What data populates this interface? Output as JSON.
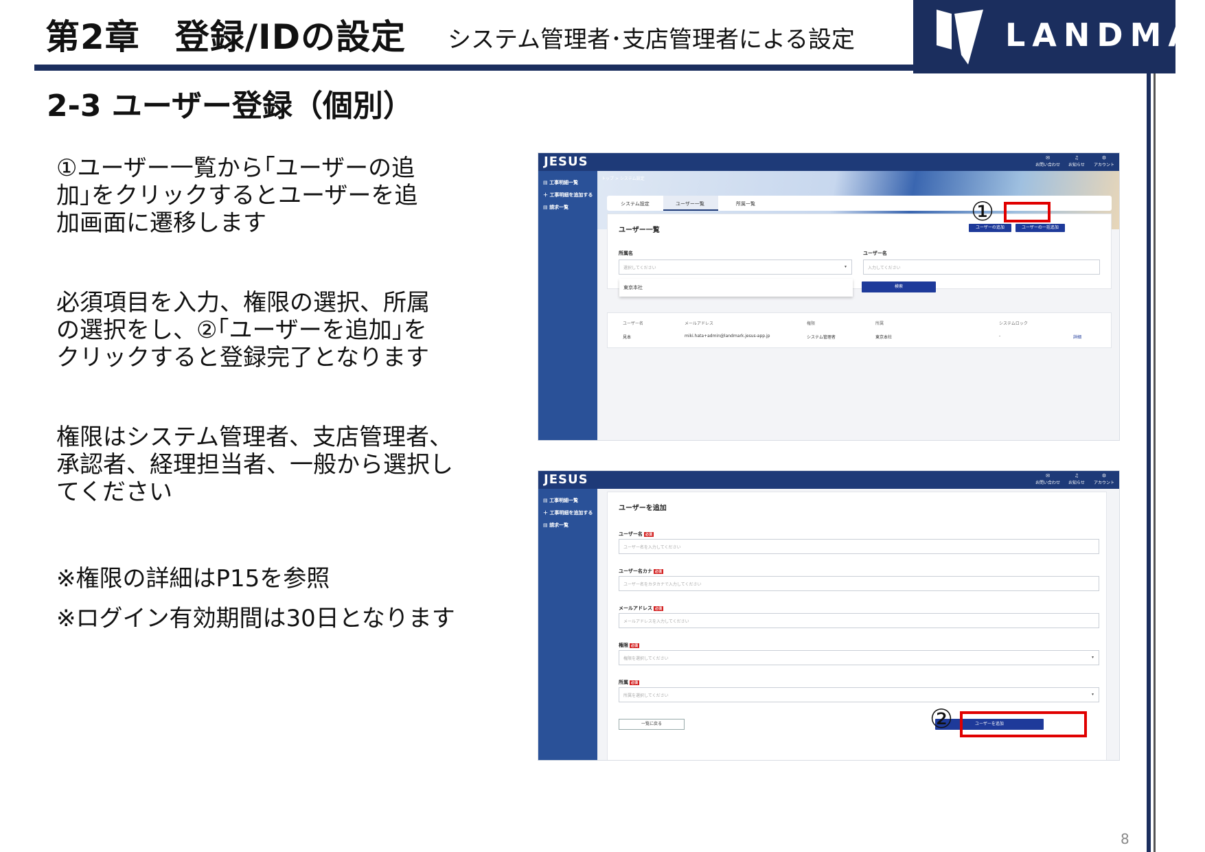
{
  "header": {
    "chapter": "第2章　登録/IDの設定",
    "subtitle": "システム管理者･支店管理者による設定",
    "logo_text": "LANDMARK"
  },
  "section_title": "2-3  ユーザー登録（個別）",
  "paragraphs": [
    "①ユーザー一覧から｢ユーザーの追加｣をクリックするとユーザーを追加画面に遷移します",
    "必須項目を入力、権限の選択、所属の選択をし、②｢ユーザーを追加｣をクリックすると登録完了となります",
    "権限はシステム管理者、支店管理者、承認者、経理担当者、一般から選択してください"
  ],
  "notes": [
    "※権限の詳細はP15を参照",
    "※ログイン有効期間は30日となります"
  ],
  "page_number": "8",
  "app": {
    "brand": "JESUS",
    "topnav": [
      {
        "icon": "mail-icon",
        "glyph": "✉",
        "label": "お問い合わせ"
      },
      {
        "icon": "bell-icon",
        "glyph": "♫",
        "label": "お知らせ"
      },
      {
        "icon": "account-icon",
        "glyph": "⚙",
        "label": "アカウント"
      }
    ],
    "sidebar": [
      {
        "icon": "▤",
        "label": "工事明細一覧"
      },
      {
        "icon": "＋",
        "label": "工事明細を追加する"
      },
      {
        "icon": "▤",
        "label": "請求一覧"
      }
    ]
  },
  "screen1": {
    "breadcrumb": "トップ  >  システム設定",
    "tabs": [
      "システム設定",
      "ユーザー一覧",
      "所属一覧"
    ],
    "card_title": "ユーザー一覧",
    "add_user_button": "ユーザーの追加",
    "bulk_add_button": "ユーザーの一括追加",
    "marker": "①",
    "filter": {
      "affiliation_label": "所属名",
      "affiliation_placeholder": "選択してください",
      "affiliation_option": "東京本社",
      "username_label": "ユーザー名",
      "username_placeholder": "入力してください",
      "search_button": "検索"
    },
    "table": {
      "headers": [
        "ユーザー名",
        "メールアドレス",
        "権限",
        "所属",
        "システムロック"
      ],
      "rows": [
        {
          "name": "見本",
          "email": "miki.hata+admin@landmark.jesus-app.jp",
          "role": "システム管理者",
          "affiliation": "東京本社",
          "lock": "-",
          "action": "詳細"
        }
      ]
    }
  },
  "screen2": {
    "card_title": "ユーザーを追加",
    "required_badge": "必須",
    "fields": [
      {
        "label": "ユーザー名",
        "placeholder": "ユーザー名を入力してください",
        "select": false
      },
      {
        "label": "ユーザー名カナ",
        "placeholder": "ユーザー名をカタカナで入力してください",
        "select": false
      },
      {
        "label": "メールアドレス",
        "placeholder": "メールアドレスを入力してください",
        "select": false
      },
      {
        "label": "権限",
        "placeholder": "権限を選択してください",
        "select": true
      },
      {
        "label": "所属",
        "placeholder": "所属を選択してください",
        "select": true
      }
    ],
    "back_button": "一覧に戻る",
    "add_button": "ユーザーを追加",
    "marker": "②"
  },
  "colors": {
    "navy": "#1b2e5e",
    "accent_red": "#e00000",
    "app_blue": "#1e3a78"
  }
}
